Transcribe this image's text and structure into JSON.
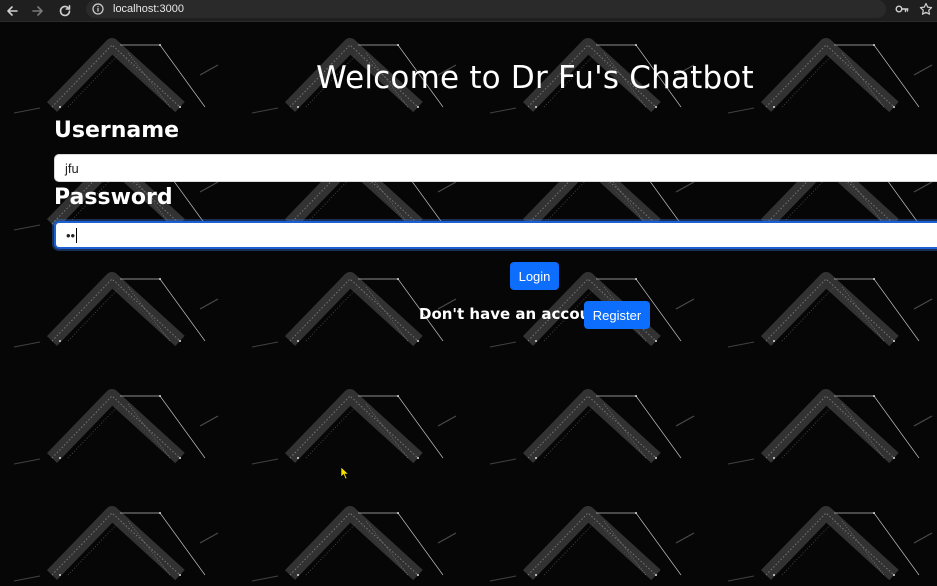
{
  "browser": {
    "url": "localhost:3000"
  },
  "page": {
    "title": "Welcome to Dr Fu's Chatbot",
    "username_label": "Username",
    "username_value": "jfu",
    "password_label": "Password",
    "password_value": "••",
    "login_label": "Login",
    "account_prompt": "Don't have an account?",
    "register_label": "Register"
  },
  "colors": {
    "button": "#0d6efd",
    "background": "#060606",
    "focus_border": "#1c5fd1"
  },
  "icons": {
    "back": "back-arrow-icon",
    "forward": "forward-arrow-icon",
    "reload": "reload-icon",
    "site_info": "info-icon",
    "password_manager": "key-icon",
    "bookmark": "star-icon",
    "pointer": "cursor-icon"
  }
}
